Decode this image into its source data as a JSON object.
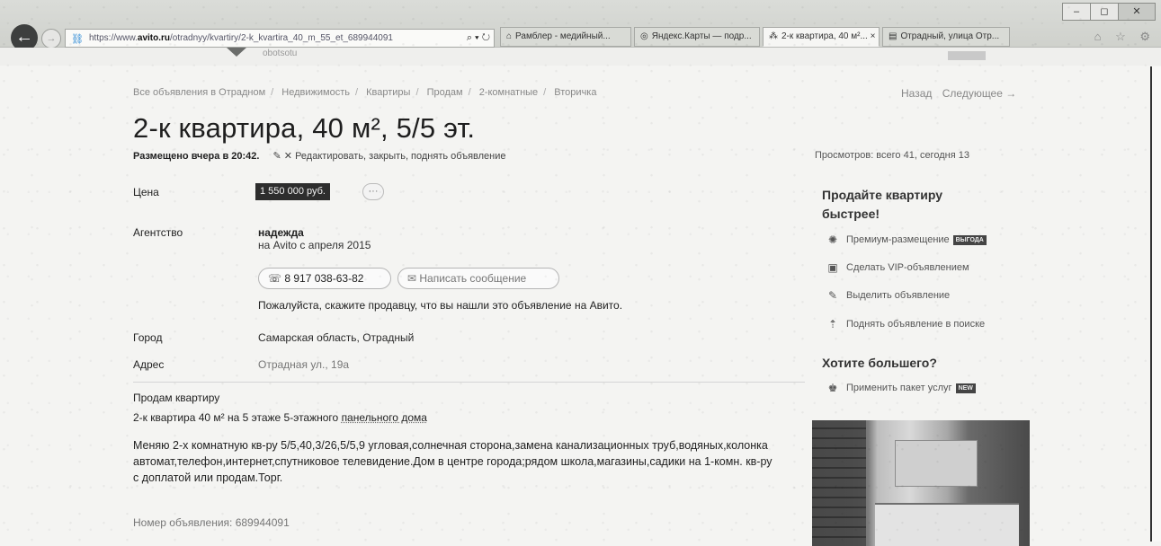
{
  "browser": {
    "window_controls": [
      "–",
      "◻",
      "✕"
    ],
    "address_prefix": "https://www.",
    "address_domain": "avito.ru",
    "address_path": "/otradnyy/kvartiry/2-k_kvartira_40_m_55_et_689944091",
    "address_buttons": "⌕ ▾ ↻",
    "tabs": [
      {
        "label": "Рамблер - медийный...",
        "active": false
      },
      {
        "label": "Яндекс.Карты — подр...",
        "active": false
      },
      {
        "label": "2-к квартира, 40 м²... ×",
        "active": true
      },
      {
        "label": "Отрадный, улица Отр...",
        "active": false
      }
    ],
    "toolbar_icons": "⌂ ☆ ⚙"
  },
  "site": {
    "sub_text": "obotsotu"
  },
  "breadcrumbs": [
    "Все объявления в Отрадном",
    "Недвижимость",
    "Квартиры",
    "Продам",
    "2-комнатные",
    "Вторичка"
  ],
  "nav": {
    "back": "Назад",
    "next": "Следующее →"
  },
  "title": "2-к квартира, 40 м², 5/5 эт.",
  "posted": {
    "time": "Размещено вчера в 20:42.",
    "edit": "✎ ✕ Редактировать, закрыть, поднять объявление"
  },
  "views": "Просмотров: всего 41, сегодня 13",
  "fields": {
    "price_label": "Цена",
    "price_value": "1 550 000 руб.",
    "price_more": "···",
    "agency_label": "Агентство",
    "agency_name": "надежда",
    "agency_since": "на Avito с апреля 2015",
    "phone": "☏ 8 917 038-63-82",
    "message": "✉ Написать сообщение",
    "tip": "Пожалуйста, скажите продавцу, что вы нашли это объявление на Авито.",
    "city_label": "Город",
    "city_value": "Самарская область, Отрадный",
    "address_label": "Адрес",
    "address_value": "Отрадная ул., 19а"
  },
  "description": {
    "title": "Продам квартиру",
    "sub_prefix": "2-к квартира 40 м² на 5 этаже 5-этажного ",
    "sub_link": "панельного дома",
    "body": "Меняю 2-х комнатную кв-ру 5/5,40,3/26,5/5,9 угловая,солнечная сторона,замена канализационных труб,водяных,колонка автомат,телефон,интернет,спутниковое телевидение.Дом в центре города;рядом школа,магазины,садики на 1-комн. кв-ру с доплатой или продам.Торг.",
    "ad_number": "Номер объявления: 689944091"
  },
  "sidebar": {
    "sell_heading": "Продайте квартиру быстрее!",
    "items": [
      {
        "label": "Премиум-размещение",
        "tag": "ВЫГОДА",
        "icon": "premium-icon"
      },
      {
        "label": "Сделать VIP-объявлением",
        "tag": "",
        "icon": "vip-icon"
      },
      {
        "label": "Выделить объявление",
        "tag": "",
        "icon": "highlight-icon"
      },
      {
        "label": "Поднять объявление в поиске",
        "tag": "",
        "icon": "raise-icon"
      }
    ],
    "more_heading": "Хотите большего?",
    "package": {
      "label": "Применить пакет услуг",
      "tag": "NEW",
      "icon": "package-icon"
    }
  }
}
